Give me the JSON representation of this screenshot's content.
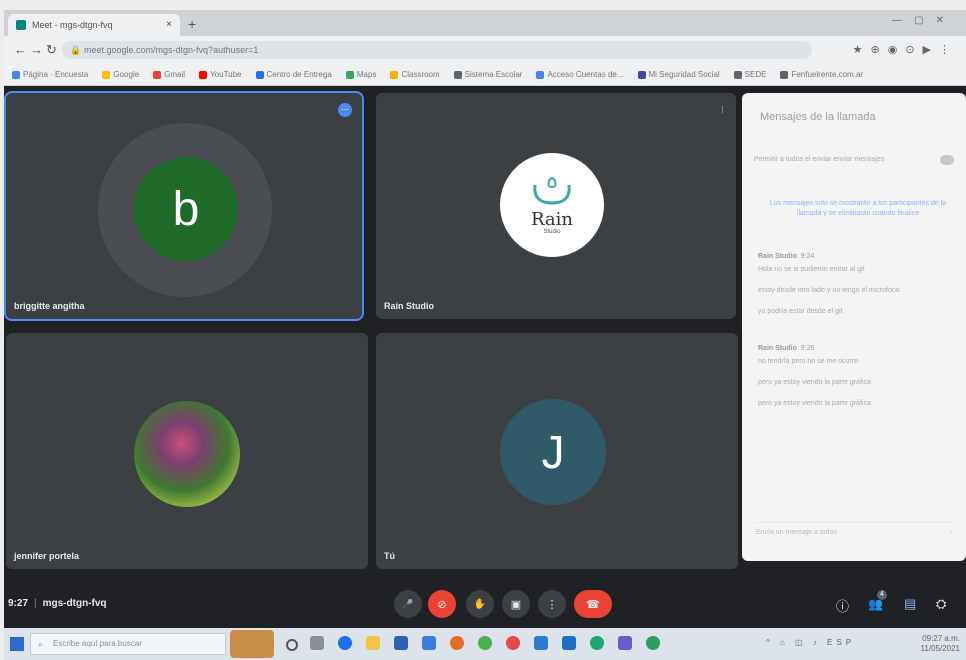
{
  "browser": {
    "tab_title": "Meet - mgs-dtgn-fvq",
    "tab_close": "×",
    "new_tab": "+",
    "url": "meet.google.com/mgs-dtgn-fvq?authuser=1",
    "bookmarks": [
      {
        "label": "Página · Encuesta",
        "color": "#4285f4"
      },
      {
        "label": "Google",
        "color": "#fbbc05"
      },
      {
        "label": "Gmail",
        "color": "#ea4335"
      },
      {
        "label": "YouTube",
        "color": "#ff0000"
      },
      {
        "label": "Centro de Entrega",
        "color": "#1a73e8"
      },
      {
        "label": "Maps",
        "color": "#34a853"
      },
      {
        "label": "Classroom",
        "color": "#f9ab00"
      },
      {
        "label": "Sistema Escolar",
        "color": "#5f6368"
      },
      {
        "label": "Acceso Cuentas de...",
        "color": "#4285f4"
      },
      {
        "label": "Mi Seguridad Social",
        "color": "#3949ab"
      },
      {
        "label": "SEDE",
        "color": "#5f6368"
      },
      {
        "label": "Fenfuelrente.com.ar",
        "color": "#5f6368"
      }
    ]
  },
  "participants": [
    {
      "name": "briggitte angitha",
      "initial": "b",
      "avatar_color": "#1e6b2a"
    },
    {
      "name": "Rain Studio",
      "logo_text": "Rain",
      "logo_sub": "Studio"
    },
    {
      "name": "jennifer portela"
    },
    {
      "name": "Tú",
      "initial": "J",
      "avatar_color": "#2f5a68"
    }
  ],
  "chat": {
    "title": "Mensajes de la llamada",
    "toggle_label": "Permitir a todos el enviar enviar mensajes",
    "note": "Los mensajes solo se mostrarán a los participantes de la llamada y se eliminarán cuando finalice",
    "groups": [
      {
        "sender": "Rain Studio",
        "time": "9:24",
        "lines": [
          "Hola no se si pudieron entrar al git",
          "estoy desde otro lado y no tengo el microfono",
          "yo podría estar desde el git"
        ]
      },
      {
        "sender": "Rain Studio",
        "time": "9:25",
        "lines": [
          "no tendría pero no se me ocurre",
          "pero ya estoy viendo la parte gráfica",
          "pero ya estoy viendo la parte gráfica"
        ]
      }
    ],
    "input_placeholder": "Envía un mensaje a todos",
    "send": "›"
  },
  "controls": {
    "time": "9:27",
    "separator": "|",
    "meeting_code": "mgs-dtgn-fvq",
    "mic": "🎤",
    "camera": "⊘",
    "raise_hand": "✋",
    "present": "▣",
    "more": "⋮",
    "hangup": "☎",
    "info": "ⓘ",
    "people": "👥",
    "people_count": "4",
    "chat": "▤",
    "activities": "⛭"
  },
  "taskbar": {
    "search_placeholder": "Escribe aquí para buscar",
    "tray_time": "09:27 a.m.",
    "tray_date": "11/05/2021",
    "lang": "ESP"
  }
}
